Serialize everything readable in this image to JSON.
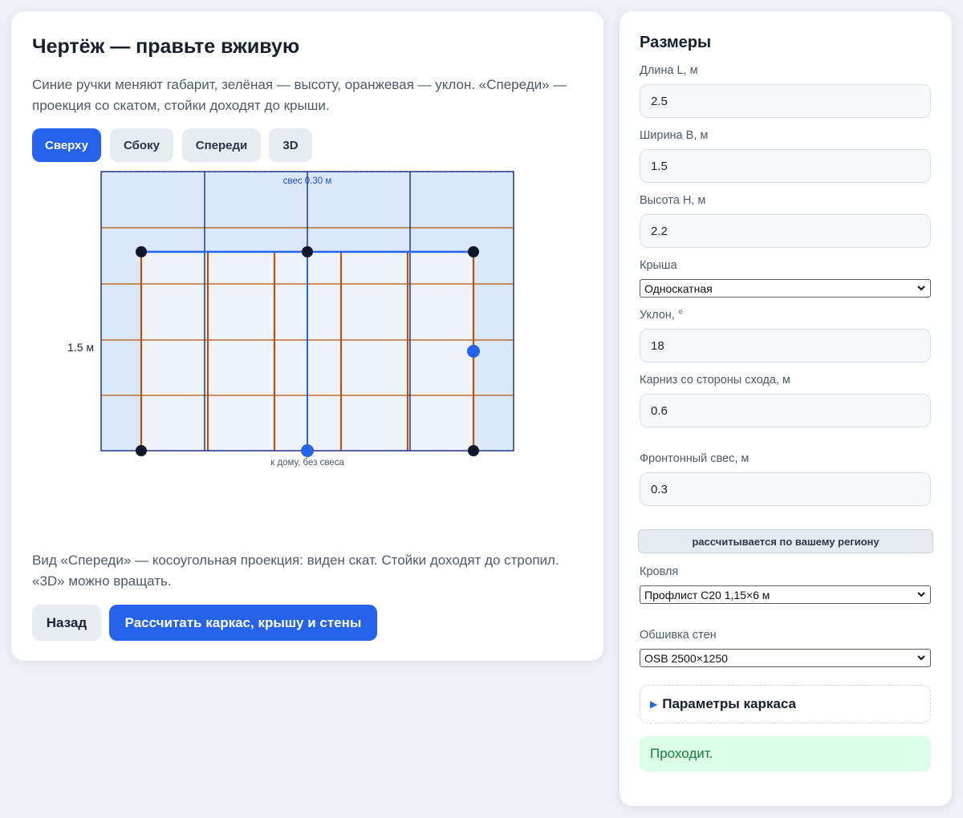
{
  "editor": {
    "title": "Чертёж — правьте вживую",
    "description": "Синие ручки меняют габарит, зелёная — высоту, оранжевая — уклон. «Спереди» — проекция со скатом, стойки доходят до крыши.",
    "tabs": [
      {
        "label": "Сверху",
        "active": true
      },
      {
        "label": "Сбоку",
        "active": false
      },
      {
        "label": "Спереди",
        "active": false
      },
      {
        "label": "3D",
        "active": false
      }
    ],
    "drawing": {
      "overhang_label": "свес 0.30 м",
      "width_label": "1.5 м",
      "house_side_label": "к дому, без свеса",
      "colors": {
        "roof_fill": "#dbe8fb",
        "floor_fill": "#eef3fb",
        "frame": "#1e3a8a",
        "rafter": "#b45309",
        "handle_dark": "#0f172a",
        "handle_blue": "#2563eb"
      }
    },
    "note": "Вид «Спереди» — косоугольная проекция: виден скат. Стойки доходят до стропил. «3D» можно вращать.",
    "back_label": "Назад",
    "calc_label": "Рассчитать каркас, крышу и стены"
  },
  "dimensions": {
    "title": "Размеры",
    "length_label": "Длина L, м",
    "length_value": "2.5",
    "width_label": "Ширина B, м",
    "width_value": "1.5",
    "height_label": "Высота H, м",
    "height_value": "2.2",
    "roof_label": "Крыша",
    "roof_value": "Односкатная",
    "slope_label": "Уклон, °",
    "slope_value": "18",
    "eave_label": "Карниз со стороны схода, м",
    "eave_value": "0.6",
    "gable_label": "Фронтонный свес, м",
    "gable_value": "0.3",
    "region_note": "рассчитывается по вашему региону",
    "roofing_label": "Кровля",
    "roofing_value": "Профлист С20 1,15×6 м",
    "sheathing_label": "Обшивка стен",
    "sheathing_value": "OSB 2500×1250",
    "frame_params_label": "Параметры каркаса",
    "status": "Проходит."
  }
}
